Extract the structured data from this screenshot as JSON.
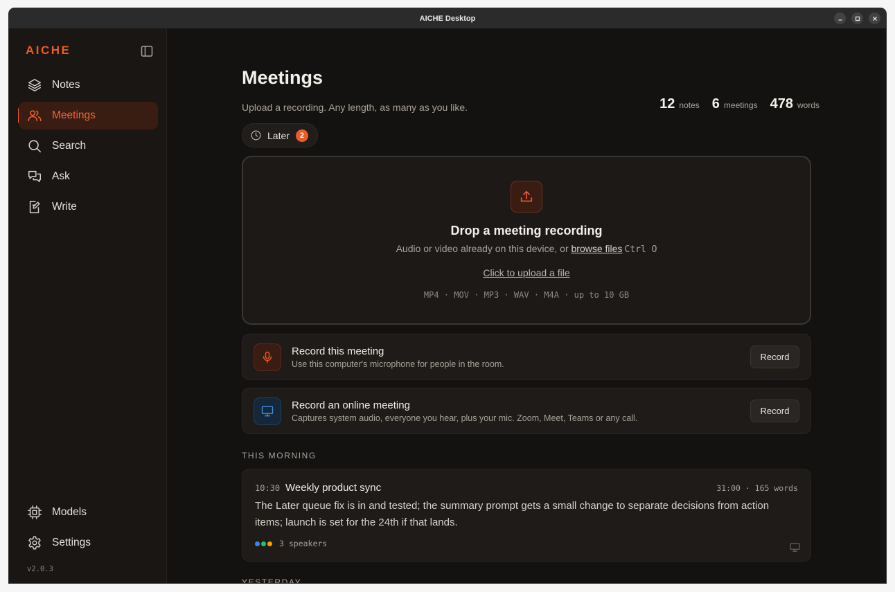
{
  "window": {
    "title": "AICHE Desktop"
  },
  "sidebar": {
    "logo": "AICHE",
    "items": [
      {
        "label": "Notes",
        "icon": "layers-icon"
      },
      {
        "label": "Meetings",
        "icon": "users-icon",
        "active": true
      },
      {
        "label": "Search",
        "icon": "search-icon"
      },
      {
        "label": "Ask",
        "icon": "chat-icon"
      },
      {
        "label": "Write",
        "icon": "edit-icon"
      }
    ],
    "bottom_items": [
      {
        "label": "Models",
        "icon": "chip-icon"
      },
      {
        "label": "Settings",
        "icon": "gear-icon"
      }
    ],
    "version": "v2.0.3"
  },
  "header": {
    "title": "Meetings",
    "subtitle": "Upload a recording. Any length, as many as you like.",
    "stats": [
      {
        "value": "12",
        "label": "notes"
      },
      {
        "value": "6",
        "label": "meetings"
      },
      {
        "value": "478",
        "label": "words"
      }
    ]
  },
  "later": {
    "label": "Later",
    "count": "2"
  },
  "dropzone": {
    "title": "Drop a meeting recording",
    "subtitle_prefix": "Audio or video already on this device, or ",
    "browse_link": "browse files",
    "shortcut": "Ctrl O",
    "click_upload": "Click to upload a file",
    "formats": "MP4 · MOV · MP3 · WAV · M4A · up to 10 GB"
  },
  "record_options": [
    {
      "title": "Record this meeting",
      "subtitle": "Use this computer's microphone for people in the room.",
      "button": "Record"
    },
    {
      "title": "Record an online meeting",
      "subtitle": "Captures system audio, everyone you hear, plus your mic. Zoom, Meet, Teams or any call.",
      "button": "Record"
    }
  ],
  "sections": [
    {
      "label": "THIS MORNING",
      "meetings": [
        {
          "time": "10:30",
          "title": "Weekly product sync",
          "meta": "31:00 · 165 words",
          "summary": "The Later queue fix is in and tested; the summary prompt gets a small change to separate decisions from action items; launch is set for the 24th if that lands.",
          "speakers": "3 speakers",
          "speaker_colors": [
            "#3b82f6",
            "#22c55e",
            "#f59e0b"
          ]
        }
      ]
    },
    {
      "label": "YESTERDAY"
    }
  ],
  "colors": {
    "accent": "#ef5a2a",
    "background": "#141210",
    "sidebar": "#191613",
    "online_icon": "#3b8fe6"
  }
}
